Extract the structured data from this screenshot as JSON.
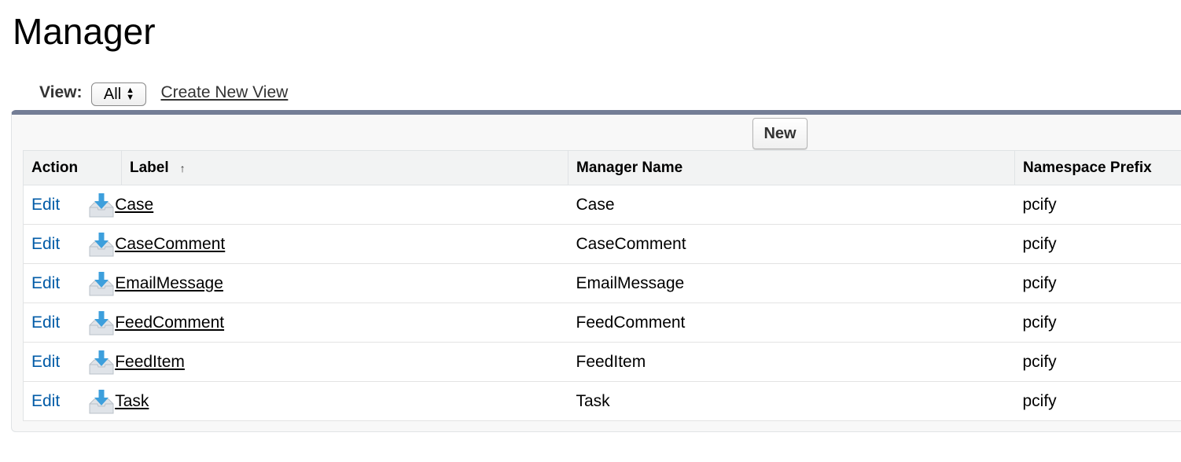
{
  "page": {
    "title": "Manager"
  },
  "view_bar": {
    "label": "View:",
    "selected": "All",
    "create_link": "Create New View"
  },
  "toolbar": {
    "new_label": "New"
  },
  "table": {
    "columns": [
      "Action",
      "Label",
      "Manager Name",
      "Namespace Prefix"
    ],
    "sort_indicator": "↑",
    "edit_label": "Edit",
    "row_icon": "download-tray-icon",
    "rows": [
      {
        "label": "Case",
        "manager_name": "Case",
        "namespace": "pcify"
      },
      {
        "label": "CaseComment",
        "manager_name": "CaseComment",
        "namespace": "pcify"
      },
      {
        "label": "EmailMessage",
        "manager_name": "EmailMessage",
        "namespace": "pcify"
      },
      {
        "label": "FeedComment",
        "manager_name": "FeedComment",
        "namespace": "pcify"
      },
      {
        "label": "FeedItem",
        "manager_name": "FeedItem",
        "namespace": "pcify"
      },
      {
        "label": "Task",
        "manager_name": "Task",
        "namespace": "pcify"
      }
    ]
  },
  "colors": {
    "link_blue": "#015ba7",
    "panel_border": "#747e96",
    "header_bg": "#f2f3f3",
    "icon_blue": "#3d9fdc"
  }
}
